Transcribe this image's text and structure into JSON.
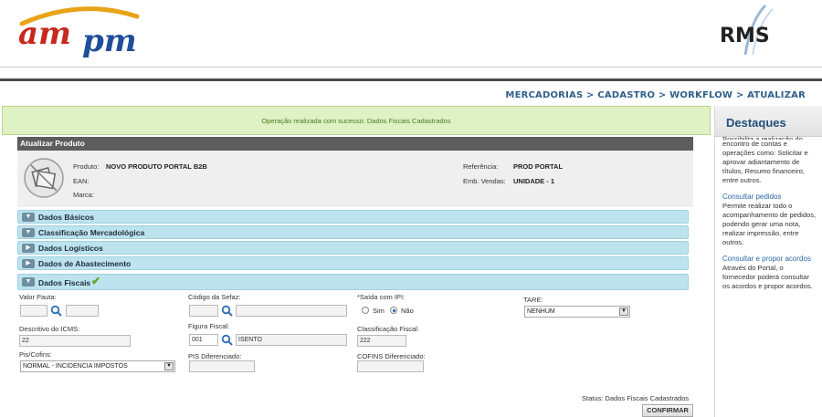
{
  "header": {
    "logo_left": "ampm",
    "logo_right": "RMS"
  },
  "breadcrumb": "MERCADORIAS > CADASTRO > WORKFLOW > ATUALIZAR",
  "success_message": "Operação realizada com sucesso: Dados Fiscais Cadastrados",
  "sidebar": {
    "title": "Destaques",
    "cut_text": "Possibilita a realização do",
    "intro_text": "encontro de contas e operações como: Solicitar e aprovar adiantamento de títulos, Resumo financeiro, entre outros.",
    "items": [
      {
        "link": "Consultar pedidos",
        "text": "Permite realizar todo o acompanhamento de pedidos, podendo gerar uma nota, realizar impressão, entre outros."
      },
      {
        "link": "Consultar e propor acordos",
        "text": "Através do Portal, o fornecedor poderá consultar os acordos e propor acordos."
      }
    ]
  },
  "panel": {
    "title": "Atualizar Produto",
    "product": {
      "produto_label": "Produto:",
      "produto_value": "NOVO PRODUTO PORTAL B2B",
      "ean_label": "EAN:",
      "marca_label": "Marca:",
      "referencia_label": "Referência:",
      "referencia_value": "PROD PORTAL",
      "emb_label": "Emb. Vendas:",
      "emb_value": "UNIDADE - 1"
    },
    "sections": [
      "Dados Básicos",
      "Classificação Mercadológica",
      "Dados Logísticos",
      "Dados de Abastecimento",
      "Dados Fiscais"
    ],
    "form": {
      "valor_pauta_label": "Valor Pauta:",
      "codigo_sefaz_label": "Código da Sefaz:",
      "saida_ipi_label": "*Saída com IPI:",
      "sim_label": "Sim",
      "nao_label": "Não",
      "tare_label": "TARE:",
      "tare_value": "NENHUM",
      "descritivo_icms_label": "Descritivo do ICMS:",
      "descritivo_icms_value": "22",
      "figura_fiscal_label": "Figura Fiscal:",
      "figura_fiscal_code": "001",
      "figura_fiscal_desc": "ISENTO",
      "classificacao_fiscal_label": "Classificação Fiscal:",
      "classificacao_fiscal_value": "222",
      "pis_cofins_label": "Pis/Cofins:",
      "pis_cofins_value": "NORMAL - INCIDENCIA IMPOSTOS",
      "pis_diferenciado_label": "PIS Diferenciado:",
      "cofins_diferenciado_label": "COFINS Diferenciado:"
    },
    "status_text": "Status: Dados Fiscais Cadastrados",
    "confirm_label": "CONFIRMAR"
  },
  "colors": {
    "accent_blue": "#2f5f8a",
    "section_bg": "#bde3ef",
    "success_bg": "#dff2c4"
  }
}
